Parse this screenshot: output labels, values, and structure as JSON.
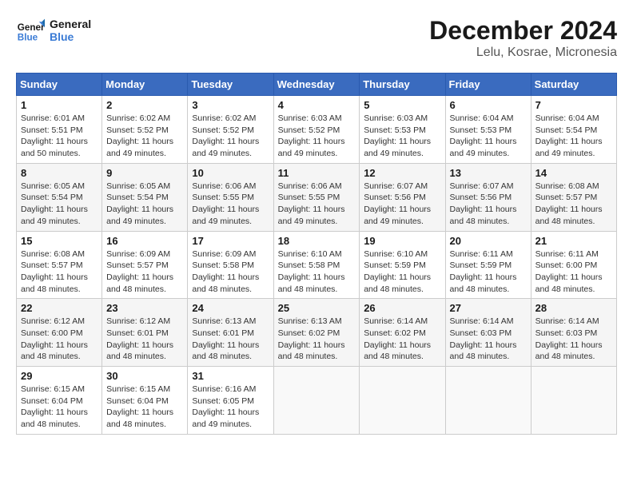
{
  "logo": {
    "text_general": "General",
    "text_blue": "Blue"
  },
  "title": "December 2024",
  "location": "Lelu, Kosrae, Micronesia",
  "days_of_week": [
    "Sunday",
    "Monday",
    "Tuesday",
    "Wednesday",
    "Thursday",
    "Friday",
    "Saturday"
  ],
  "weeks": [
    [
      {
        "day": "1",
        "info": "Sunrise: 6:01 AM\nSunset: 5:51 PM\nDaylight: 11 hours\nand 50 minutes."
      },
      {
        "day": "2",
        "info": "Sunrise: 6:02 AM\nSunset: 5:52 PM\nDaylight: 11 hours\nand 49 minutes."
      },
      {
        "day": "3",
        "info": "Sunrise: 6:02 AM\nSunset: 5:52 PM\nDaylight: 11 hours\nand 49 minutes."
      },
      {
        "day": "4",
        "info": "Sunrise: 6:03 AM\nSunset: 5:52 PM\nDaylight: 11 hours\nand 49 minutes."
      },
      {
        "day": "5",
        "info": "Sunrise: 6:03 AM\nSunset: 5:53 PM\nDaylight: 11 hours\nand 49 minutes."
      },
      {
        "day": "6",
        "info": "Sunrise: 6:04 AM\nSunset: 5:53 PM\nDaylight: 11 hours\nand 49 minutes."
      },
      {
        "day": "7",
        "info": "Sunrise: 6:04 AM\nSunset: 5:54 PM\nDaylight: 11 hours\nand 49 minutes."
      }
    ],
    [
      {
        "day": "8",
        "info": "Sunrise: 6:05 AM\nSunset: 5:54 PM\nDaylight: 11 hours\nand 49 minutes."
      },
      {
        "day": "9",
        "info": "Sunrise: 6:05 AM\nSunset: 5:54 PM\nDaylight: 11 hours\nand 49 minutes."
      },
      {
        "day": "10",
        "info": "Sunrise: 6:06 AM\nSunset: 5:55 PM\nDaylight: 11 hours\nand 49 minutes."
      },
      {
        "day": "11",
        "info": "Sunrise: 6:06 AM\nSunset: 5:55 PM\nDaylight: 11 hours\nand 49 minutes."
      },
      {
        "day": "12",
        "info": "Sunrise: 6:07 AM\nSunset: 5:56 PM\nDaylight: 11 hours\nand 49 minutes."
      },
      {
        "day": "13",
        "info": "Sunrise: 6:07 AM\nSunset: 5:56 PM\nDaylight: 11 hours\nand 48 minutes."
      },
      {
        "day": "14",
        "info": "Sunrise: 6:08 AM\nSunset: 5:57 PM\nDaylight: 11 hours\nand 48 minutes."
      }
    ],
    [
      {
        "day": "15",
        "info": "Sunrise: 6:08 AM\nSunset: 5:57 PM\nDaylight: 11 hours\nand 48 minutes."
      },
      {
        "day": "16",
        "info": "Sunrise: 6:09 AM\nSunset: 5:57 PM\nDaylight: 11 hours\nand 48 minutes."
      },
      {
        "day": "17",
        "info": "Sunrise: 6:09 AM\nSunset: 5:58 PM\nDaylight: 11 hours\nand 48 minutes."
      },
      {
        "day": "18",
        "info": "Sunrise: 6:10 AM\nSunset: 5:58 PM\nDaylight: 11 hours\nand 48 minutes."
      },
      {
        "day": "19",
        "info": "Sunrise: 6:10 AM\nSunset: 5:59 PM\nDaylight: 11 hours\nand 48 minutes."
      },
      {
        "day": "20",
        "info": "Sunrise: 6:11 AM\nSunset: 5:59 PM\nDaylight: 11 hours\nand 48 minutes."
      },
      {
        "day": "21",
        "info": "Sunrise: 6:11 AM\nSunset: 6:00 PM\nDaylight: 11 hours\nand 48 minutes."
      }
    ],
    [
      {
        "day": "22",
        "info": "Sunrise: 6:12 AM\nSunset: 6:00 PM\nDaylight: 11 hours\nand 48 minutes."
      },
      {
        "day": "23",
        "info": "Sunrise: 6:12 AM\nSunset: 6:01 PM\nDaylight: 11 hours\nand 48 minutes."
      },
      {
        "day": "24",
        "info": "Sunrise: 6:13 AM\nSunset: 6:01 PM\nDaylight: 11 hours\nand 48 minutes."
      },
      {
        "day": "25",
        "info": "Sunrise: 6:13 AM\nSunset: 6:02 PM\nDaylight: 11 hours\nand 48 minutes."
      },
      {
        "day": "26",
        "info": "Sunrise: 6:14 AM\nSunset: 6:02 PM\nDaylight: 11 hours\nand 48 minutes."
      },
      {
        "day": "27",
        "info": "Sunrise: 6:14 AM\nSunset: 6:03 PM\nDaylight: 11 hours\nand 48 minutes."
      },
      {
        "day": "28",
        "info": "Sunrise: 6:14 AM\nSunset: 6:03 PM\nDaylight: 11 hours\nand 48 minutes."
      }
    ],
    [
      {
        "day": "29",
        "info": "Sunrise: 6:15 AM\nSunset: 6:04 PM\nDaylight: 11 hours\nand 48 minutes."
      },
      {
        "day": "30",
        "info": "Sunrise: 6:15 AM\nSunset: 6:04 PM\nDaylight: 11 hours\nand 48 minutes."
      },
      {
        "day": "31",
        "info": "Sunrise: 6:16 AM\nSunset: 6:05 PM\nDaylight: 11 hours\nand 49 minutes."
      },
      {
        "day": "",
        "info": ""
      },
      {
        "day": "",
        "info": ""
      },
      {
        "day": "",
        "info": ""
      },
      {
        "day": "",
        "info": ""
      }
    ]
  ]
}
